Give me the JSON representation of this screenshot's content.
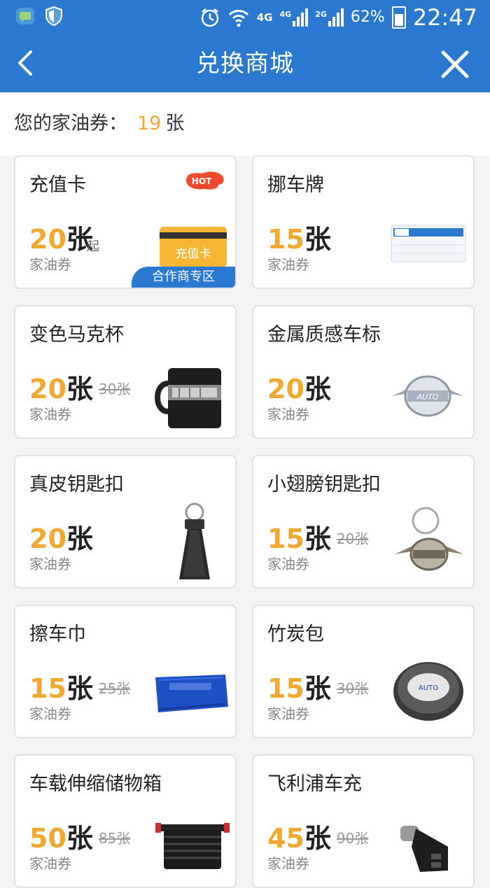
{
  "status_bar": {
    "network_4g": "4G",
    "sim1": "4G",
    "sim2": "2G",
    "battery": "62%",
    "time": "22:47"
  },
  "nav": {
    "title": "兑换商城"
  },
  "balance": {
    "label": "您的家油券：",
    "count": "19",
    "unit": "张"
  },
  "items": [
    {
      "name": "充值卡",
      "price": "20",
      "unit": "张",
      "suffix": "起",
      "old_price": "",
      "label": "家油券",
      "hot": "HOT",
      "img_text": "充值卡",
      "partner": "合作商专区",
      "icon": "recharge-card-icon"
    },
    {
      "name": "挪车牌",
      "price": "15",
      "unit": "张",
      "old_price": "",
      "label": "家油券",
      "icon": "parking-sign-icon"
    },
    {
      "name": "变色马克杯",
      "price": "20",
      "unit": "张",
      "old_price": "30张",
      "label": "家油券",
      "icon": "mug-icon"
    },
    {
      "name": "金属质感车标",
      "price": "20",
      "unit": "张",
      "old_price": "",
      "label": "家油券",
      "icon": "car-emblem-icon"
    },
    {
      "name": "真皮钥匙扣",
      "price": "20",
      "unit": "张",
      "old_price": "",
      "label": "家油券",
      "icon": "leather-keychain-icon"
    },
    {
      "name": "小翅膀钥匙扣",
      "price": "15",
      "unit": "张",
      "old_price": "20张",
      "label": "家油券",
      "icon": "wing-keychain-icon"
    },
    {
      "name": "擦车巾",
      "price": "15",
      "unit": "张",
      "old_price": "25张",
      "label": "家油券",
      "icon": "towel-icon"
    },
    {
      "name": "竹炭包",
      "price": "15",
      "unit": "张",
      "old_price": "30张",
      "label": "家油券",
      "icon": "charcoal-bag-icon"
    },
    {
      "name": "车载伸缩储物箱",
      "price": "50",
      "unit": "张",
      "old_price": "85张",
      "label": "家油券",
      "icon": "storage-box-icon"
    },
    {
      "name": "飞利浦车充",
      "price": "45",
      "unit": "张",
      "old_price": "90张",
      "label": "家油券",
      "icon": "car-charger-icon"
    }
  ],
  "colors": {
    "brand_blue": "#2a78d0",
    "price_orange": "#f0a830"
  }
}
